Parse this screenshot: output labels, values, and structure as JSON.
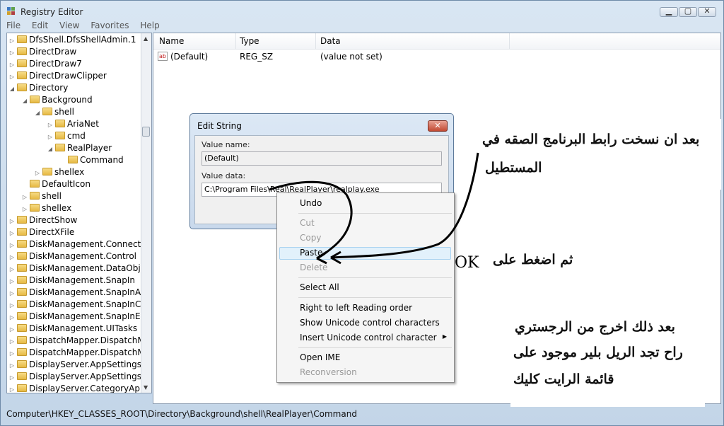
{
  "window": {
    "title": "Registry Editor"
  },
  "menu": [
    "File",
    "Edit",
    "View",
    "Favorites",
    "Help"
  ],
  "tree": [
    {
      "label": "DfsShell.DfsShellAdmin.1",
      "depth": 0,
      "exp": "▷"
    },
    {
      "label": "DirectDraw",
      "depth": 0,
      "exp": "▷"
    },
    {
      "label": "DirectDraw7",
      "depth": 0,
      "exp": "▷"
    },
    {
      "label": "DirectDrawClipper",
      "depth": 0,
      "exp": "▷"
    },
    {
      "label": "Directory",
      "depth": 0,
      "exp": "◢"
    },
    {
      "label": "Background",
      "depth": 1,
      "exp": "◢"
    },
    {
      "label": "shell",
      "depth": 2,
      "exp": "◢"
    },
    {
      "label": "AriaNet",
      "depth": 3,
      "exp": "▷"
    },
    {
      "label": "cmd",
      "depth": 3,
      "exp": "▷"
    },
    {
      "label": "RealPlayer",
      "depth": 3,
      "exp": "◢"
    },
    {
      "label": "Command",
      "depth": 4,
      "exp": ""
    },
    {
      "label": "shellex",
      "depth": 2,
      "exp": "▷"
    },
    {
      "label": "DefaultIcon",
      "depth": 1,
      "exp": ""
    },
    {
      "label": "shell",
      "depth": 1,
      "exp": "▷"
    },
    {
      "label": "shellex",
      "depth": 1,
      "exp": "▷"
    },
    {
      "label": "DirectShow",
      "depth": 0,
      "exp": "▷"
    },
    {
      "label": "DirectXFile",
      "depth": 0,
      "exp": "▷"
    },
    {
      "label": "DiskManagement.Connection",
      "depth": 0,
      "exp": "▷"
    },
    {
      "label": "DiskManagement.Control",
      "depth": 0,
      "exp": "▷"
    },
    {
      "label": "DiskManagement.DataObject",
      "depth": 0,
      "exp": "▷"
    },
    {
      "label": "DiskManagement.SnapIn",
      "depth": 0,
      "exp": "▷"
    },
    {
      "label": "DiskManagement.SnapInAbou",
      "depth": 0,
      "exp": "▷"
    },
    {
      "label": "DiskManagement.SnapInCom",
      "depth": 0,
      "exp": "▷"
    },
    {
      "label": "DiskManagement.SnapInExten",
      "depth": 0,
      "exp": "▷"
    },
    {
      "label": "DiskManagement.UITasks",
      "depth": 0,
      "exp": "▷"
    },
    {
      "label": "DispatchMapper.DispatchMapp",
      "depth": 0,
      "exp": "▷"
    },
    {
      "label": "DispatchMapper.DispatchMap",
      "depth": 0,
      "exp": "▷"
    },
    {
      "label": "DisplayServer.AppSettingsBasi",
      "depth": 0,
      "exp": "▷"
    },
    {
      "label": "DisplayServer.AppSettingsBasi",
      "depth": 0,
      "exp": "▷"
    },
    {
      "label": "DisplayServer.CategoryAppear",
      "depth": 0,
      "exp": "▷"
    }
  ],
  "list": {
    "headers": {
      "name": "Name",
      "type": "Type",
      "data": "Data"
    },
    "rows": [
      {
        "name": "(Default)",
        "type": "REG_SZ",
        "data": "(value not set)"
      }
    ]
  },
  "status": "Computer\\HKEY_CLASSES_ROOT\\Directory\\Background\\shell\\RealPlayer\\Command",
  "dialog": {
    "title": "Edit String",
    "value_name_label": "Value name:",
    "value_name": "(Default)",
    "value_data_label": "Value data:",
    "value_data": "C:\\Program Files\\Real\\RealPlayer\\realplay.exe"
  },
  "context_menu": {
    "undo": "Undo",
    "cut": "Cut",
    "copy": "Copy",
    "paste": "Paste",
    "delete": "Delete",
    "select_all": "Select All",
    "rtl": "Right to left Reading order",
    "show_unicode": "Show Unicode control characters",
    "insert_unicode": "Insert Unicode control character",
    "open_ime": "Open IME",
    "reconversion": "Reconversion"
  },
  "annotations": {
    "line1": "بعد ان نسخت رابط البرنامج الصقه في",
    "line2": "المستطيل",
    "press_ok": "ثم اضغط على",
    "ok": "OK",
    "after1": "بعد ذلك اخرج من الرجستري",
    "after2": "راح تجد الريل بلير موجود على",
    "after3": "قائمة الرايت كليك"
  }
}
